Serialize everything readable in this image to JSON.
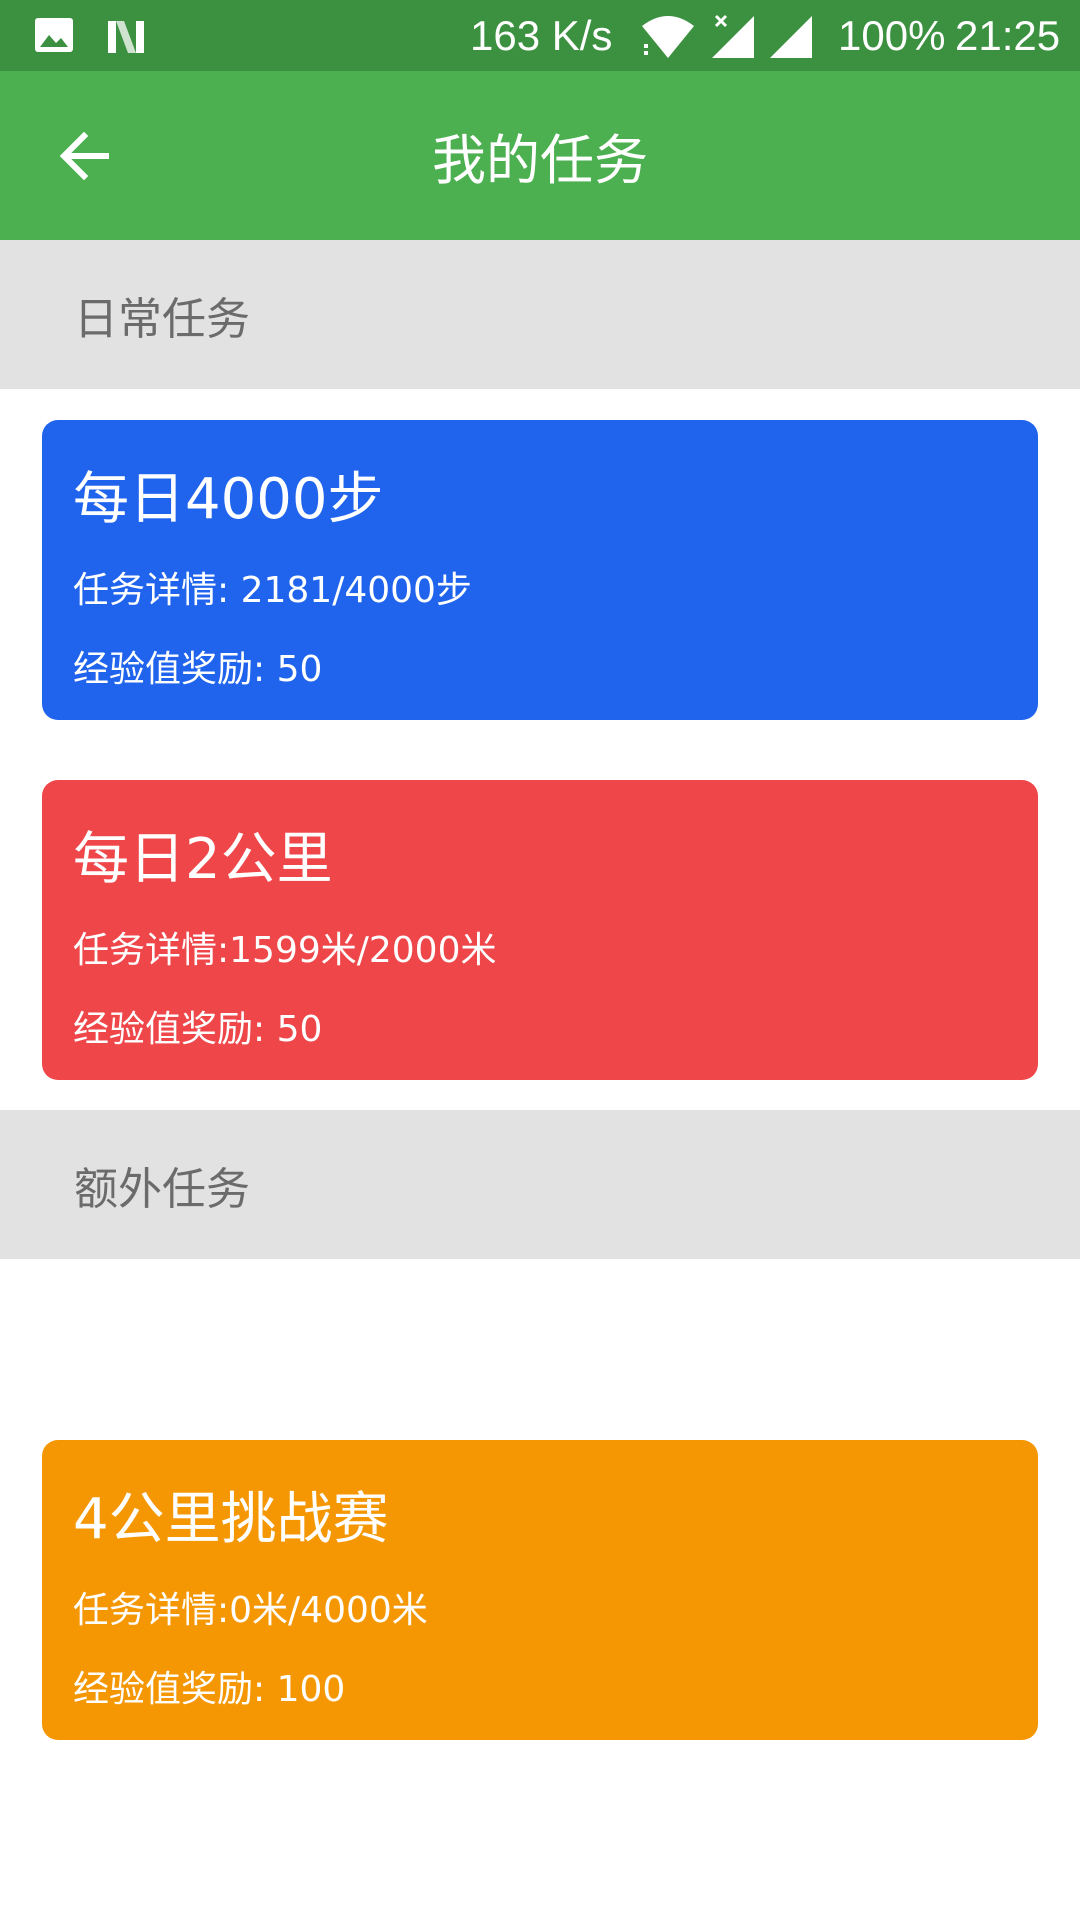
{
  "status_bar": {
    "speed": "163 K/s",
    "battery": "100%",
    "time": "21:25",
    "icons": [
      "image-icon",
      "n-icon",
      "wifi-icon",
      "signal-icon",
      "signal-icon"
    ]
  },
  "app_bar": {
    "title": "我的任务",
    "back_icon": "arrow-left-icon",
    "color": "#4caf50"
  },
  "sections": {
    "daily": {
      "label": "日常任务"
    },
    "extra": {
      "label": "额外任务"
    }
  },
  "tasks": [
    {
      "title": "每日4000步",
      "detail": "任务详情: 2181/4000步",
      "reward": "经验值奖励: 50",
      "color": "#2064ee"
    },
    {
      "title": "每日2公里",
      "detail": "任务详情:1599米/2000米",
      "reward": "经验值奖励: 50",
      "color": "#ef4649"
    },
    {
      "title": "4公里挑战赛",
      "detail": "任务详情:0米/4000米",
      "reward": "经验值奖励: 100",
      "color": "#f59703"
    }
  ]
}
